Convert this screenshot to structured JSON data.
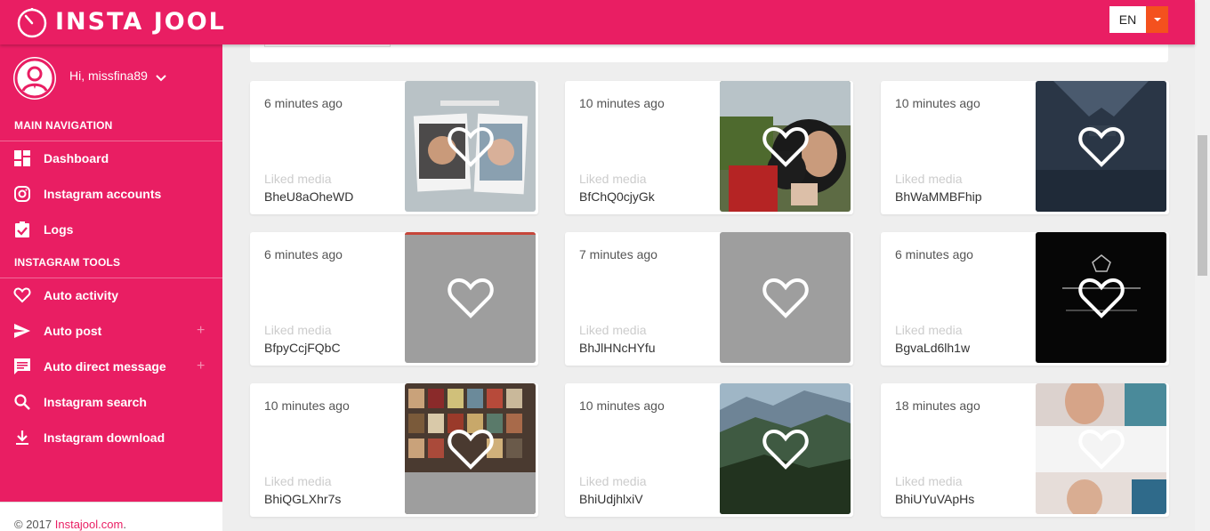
{
  "app": {
    "logo_text": "INSTA JOOL",
    "language": "EN"
  },
  "user": {
    "greeting": "Hi, missfina89"
  },
  "sidebar": {
    "main_title": "MAIN NAVIGATION",
    "tools_title": "INSTAGRAM TOOLS",
    "items": [
      {
        "label": "Dashboard",
        "icon": "dashboard-icon"
      },
      {
        "label": "Instagram accounts",
        "icon": "instagram-icon"
      },
      {
        "label": "Logs",
        "icon": "clipboard-check-icon"
      },
      {
        "label": "Auto activity",
        "icon": "heart-icon"
      },
      {
        "label": "Auto post",
        "icon": "send-icon",
        "plus": "+"
      },
      {
        "label": "Auto direct message",
        "icon": "message-icon",
        "plus": "+"
      },
      {
        "label": "Instagram search",
        "icon": "search-icon"
      },
      {
        "label": "Instagram download",
        "icon": "download-icon"
      }
    ]
  },
  "footer": {
    "prefix": "© 2017 ",
    "link": "Instajool.com",
    "suffix": "."
  },
  "colors": {
    "brand": "#e91e63",
    "accent": "#f4511e"
  },
  "activities": [
    {
      "time": "6 minutes ago",
      "action": "Liked media",
      "code": "BheU8aOheWD",
      "thumb": "testimoni-photo"
    },
    {
      "time": "10 minutes ago",
      "action": "Liked media",
      "code": "BfChQ0cjyGk",
      "thumb": "selfie-photo"
    },
    {
      "time": "10 minutes ago",
      "action": "Liked media",
      "code": "BhWaMMBFhip",
      "thumb": "shirt-photo"
    },
    {
      "time": "6 minutes ago",
      "action": "Liked media",
      "code": "BfpyCcjFQbC",
      "thumb": "gray-placeholder"
    },
    {
      "time": "7 minutes ago",
      "action": "Liked media",
      "code": "BhJlHNcHYfu",
      "thumb": "gray-placeholder"
    },
    {
      "time": "6 minutes ago",
      "action": "Liked media",
      "code": "BgvaLd6lh1w",
      "thumb": "reflections-photo"
    },
    {
      "time": "10 minutes ago",
      "action": "Liked media",
      "code": "BhiQGLXhr7s",
      "thumb": "shop-photo"
    },
    {
      "time": "10 minutes ago",
      "action": "Liked media",
      "code": "BhiUdjhlxiV",
      "thumb": "mountain-photo"
    },
    {
      "time": "18 minutes ago",
      "action": "Liked media",
      "code": "BhiUYuVApHs",
      "thumb": "ad-photo"
    }
  ]
}
